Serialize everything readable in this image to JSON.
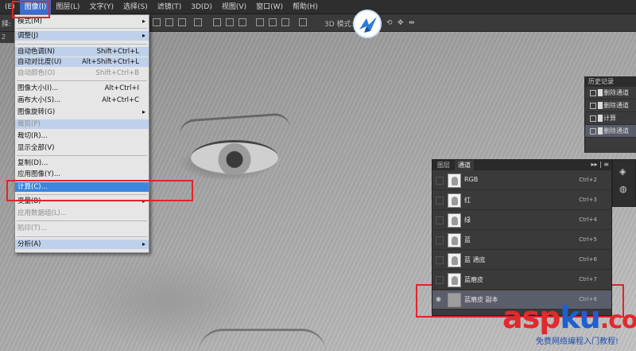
{
  "menubar": {
    "items": [
      {
        "label": "(E)"
      },
      {
        "label": "图像(I)",
        "active": true
      },
      {
        "label": "图层(L)"
      },
      {
        "label": "文字(Y)"
      },
      {
        "label": "选择(S)"
      },
      {
        "label": "滤镜(T)"
      },
      {
        "label": "3D(D)"
      },
      {
        "label": "视图(V)"
      },
      {
        "label": "窗口(W)"
      },
      {
        "label": "帮助(H)"
      }
    ]
  },
  "optbar": {
    "label": "择:",
    "mode3d": "3D 模式:"
  },
  "docstrip": {
    "label": "2"
  },
  "image_menu": {
    "items": [
      {
        "label": "模式(M)",
        "shortcut": "",
        "submenu": true,
        "state": "normal"
      },
      {
        "label": "调整(J)",
        "shortcut": "",
        "submenu": true,
        "state": "hl"
      },
      {
        "label": "自动色调(N)",
        "shortcut": "Shift+Ctrl+L",
        "state": "hl"
      },
      {
        "label": "自动对比度(U)",
        "shortcut": "Alt+Shift+Ctrl+L",
        "state": "hl"
      },
      {
        "label": "自动颜色(O)",
        "shortcut": "Shift+Ctrl+B",
        "state": "dis"
      },
      {
        "label": "图像大小(I)...",
        "shortcut": "Alt+Ctrl+I",
        "state": "normal"
      },
      {
        "label": "画布大小(S)...",
        "shortcut": "Alt+Ctrl+C",
        "state": "normal"
      },
      {
        "label": "图像旋转(G)",
        "shortcut": "",
        "submenu": true,
        "state": "normal"
      },
      {
        "label": "裁剪(P)",
        "shortcut": "",
        "state": "hl-dis"
      },
      {
        "label": "裁切(R)...",
        "shortcut": "",
        "state": "normal"
      },
      {
        "label": "显示全部(V)",
        "shortcut": "",
        "state": "normal"
      },
      {
        "label": "复制(D)...",
        "shortcut": "",
        "state": "normal"
      },
      {
        "label": "应用图像(Y)...",
        "shortcut": "",
        "state": "normal"
      },
      {
        "label": "计算(C)...",
        "shortcut": "",
        "state": "sel"
      },
      {
        "label": "变量(B)",
        "shortcut": "",
        "submenu": true,
        "state": "normal"
      },
      {
        "label": "应用数据组(L)...",
        "shortcut": "",
        "state": "dis"
      },
      {
        "label": "陷印(T)...",
        "shortcut": "",
        "state": "dis"
      },
      {
        "label": "分析(A)",
        "shortcut": "",
        "submenu": true,
        "state": "hl"
      }
    ]
  },
  "history": {
    "title": "历史记录",
    "items": [
      {
        "label": "删除通道"
      },
      {
        "label": "删除通道"
      },
      {
        "label": "计算"
      },
      {
        "label": "删除通道",
        "selected": true
      }
    ]
  },
  "channels": {
    "tabs": [
      "图层",
      "通道"
    ],
    "active_tab": 1,
    "menu": "▸▸ | ≡",
    "rows": [
      {
        "name": "RGB",
        "shortcut": "Ctrl+2"
      },
      {
        "name": "红",
        "shortcut": "Ctrl+3"
      },
      {
        "name": "绿",
        "shortcut": "Ctrl+4"
      },
      {
        "name": "蓝",
        "shortcut": "Ctrl+5"
      },
      {
        "name": "蓝 通底",
        "shortcut": "Ctrl+6"
      },
      {
        "name": "蓝磨皮",
        "shortcut": "Ctrl+7"
      },
      {
        "name": "蓝磨皮 副本",
        "shortcut": "Ctrl+8",
        "selected": true
      }
    ]
  },
  "watermark": {
    "part1": "asp",
    "part2": "ku",
    "part3": ".com",
    "sub": "免费网络编程入门教程!"
  }
}
